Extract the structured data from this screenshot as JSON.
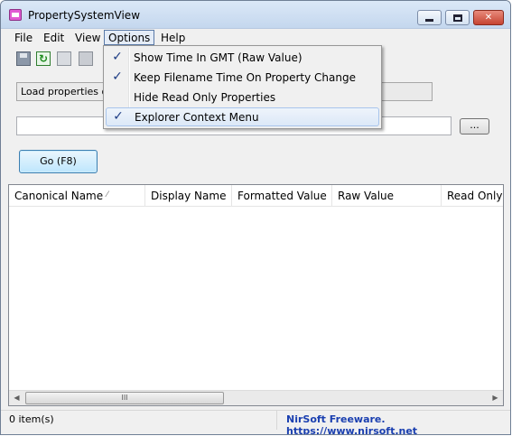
{
  "window": {
    "title": "PropertySystemView"
  },
  "menu": {
    "file": "File",
    "edit": "Edit",
    "view": "View",
    "options": "Options",
    "help": "Help"
  },
  "toolbar": {
    "icons": [
      "save-icon",
      "refresh-icon",
      "copy-icon",
      "properties-icon"
    ]
  },
  "controls": {
    "load_combo_value": "Load properties of",
    "file_path_value": "",
    "browse_label": "...",
    "go_label": "Go (F8)"
  },
  "listview": {
    "columns": [
      "Canonical Name",
      "Display Name",
      "Formatted Value",
      "Raw Value",
      "Read Only"
    ],
    "sort_indicator": "⁄",
    "rows": [],
    "scroll_grip": "III"
  },
  "status": {
    "items": "0 item(s)",
    "link": "NirSoft Freeware. https://www.nirsoft.net"
  },
  "options_menu": {
    "items": [
      {
        "label": "Show Time In GMT (Raw Value)",
        "checked": true,
        "check": "✓"
      },
      {
        "label": "Keep Filename Time On Property Change",
        "checked": true,
        "check": "✓"
      },
      {
        "label": "Hide Read Only Properties",
        "checked": false,
        "check": ""
      },
      {
        "label": "Explorer Context Menu",
        "checked": true,
        "check": "✓"
      }
    ]
  },
  "colors": {
    "accent": "#3c7fb1",
    "link": "#1a3fb0",
    "check": "#1d3c84"
  }
}
